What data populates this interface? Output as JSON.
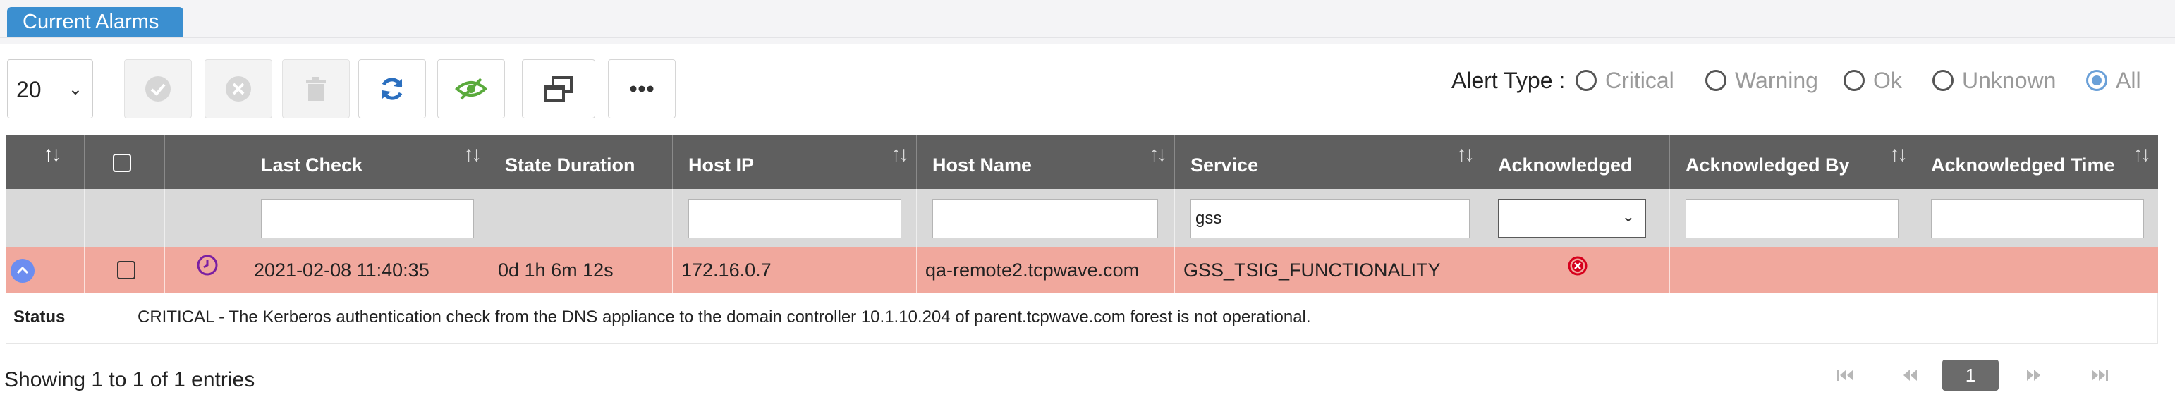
{
  "tab": {
    "title": "Current Alarms"
  },
  "toolbar": {
    "page_size": "20",
    "buttons": [
      {
        "name": "acknowledge-button",
        "icon": "check-circle-icon",
        "enabled": false
      },
      {
        "name": "unacknowledge-button",
        "icon": "x-circle-icon",
        "enabled": false
      },
      {
        "name": "delete-button",
        "icon": "trash-icon",
        "enabled": false
      },
      {
        "name": "refresh-button",
        "icon": "refresh-icon",
        "enabled": true
      },
      {
        "name": "toggle-visibility-button",
        "icon": "eye-slash-icon",
        "enabled": true
      },
      {
        "name": "column-toggle-button",
        "icon": "windows-icon",
        "enabled": true
      },
      {
        "name": "more-button",
        "icon": "ellipsis-icon",
        "enabled": true
      }
    ]
  },
  "alert_type": {
    "label": "Alert Type :",
    "options": [
      "Critical",
      "Warning",
      "Ok",
      "Unknown",
      "All"
    ],
    "selected": "All"
  },
  "table": {
    "headers": {
      "last_check": "Last Check",
      "state_duration": "State Duration",
      "host_ip": "Host IP",
      "host_name": "Host Name",
      "service": "Service",
      "acknowledged": "Acknowledged",
      "acknowledged_by": "Acknowledged By",
      "acknowledged_time": "Acknowledged Time"
    },
    "filters": {
      "last_check": "",
      "host_ip": "",
      "host_name": "",
      "service": "gss",
      "acknowledged_by": "",
      "acknowledged_time": ""
    },
    "rows": [
      {
        "last_check": "2021-02-08 11:40:35",
        "state_duration": "0d 1h 6m 12s",
        "host_ip": "172.16.0.7",
        "host_name": "qa-remote2.tcpwave.com",
        "service": "GSS_TSIG_FUNCTIONALITY",
        "acknowledged_icon": "x-circle-icon",
        "acknowledged_by": "",
        "acknowledged_time": "",
        "status_label": "Status",
        "status_text": "CRITICAL - The Kerberos authentication check from the DNS appliance to the domain controller 10.1.10.204 of parent.tcpwave.com forest is not operational."
      }
    ]
  },
  "footer": {
    "showing": "Showing 1 to 1 of 1 entries",
    "current_page": "1"
  },
  "colors": {
    "tab": "#3b8fd0",
    "header": "#5f5f5f",
    "critical_row": "#f1a89d",
    "refresh_icon": "#2b6fbf",
    "eye_icon": "#5aaa3c"
  }
}
